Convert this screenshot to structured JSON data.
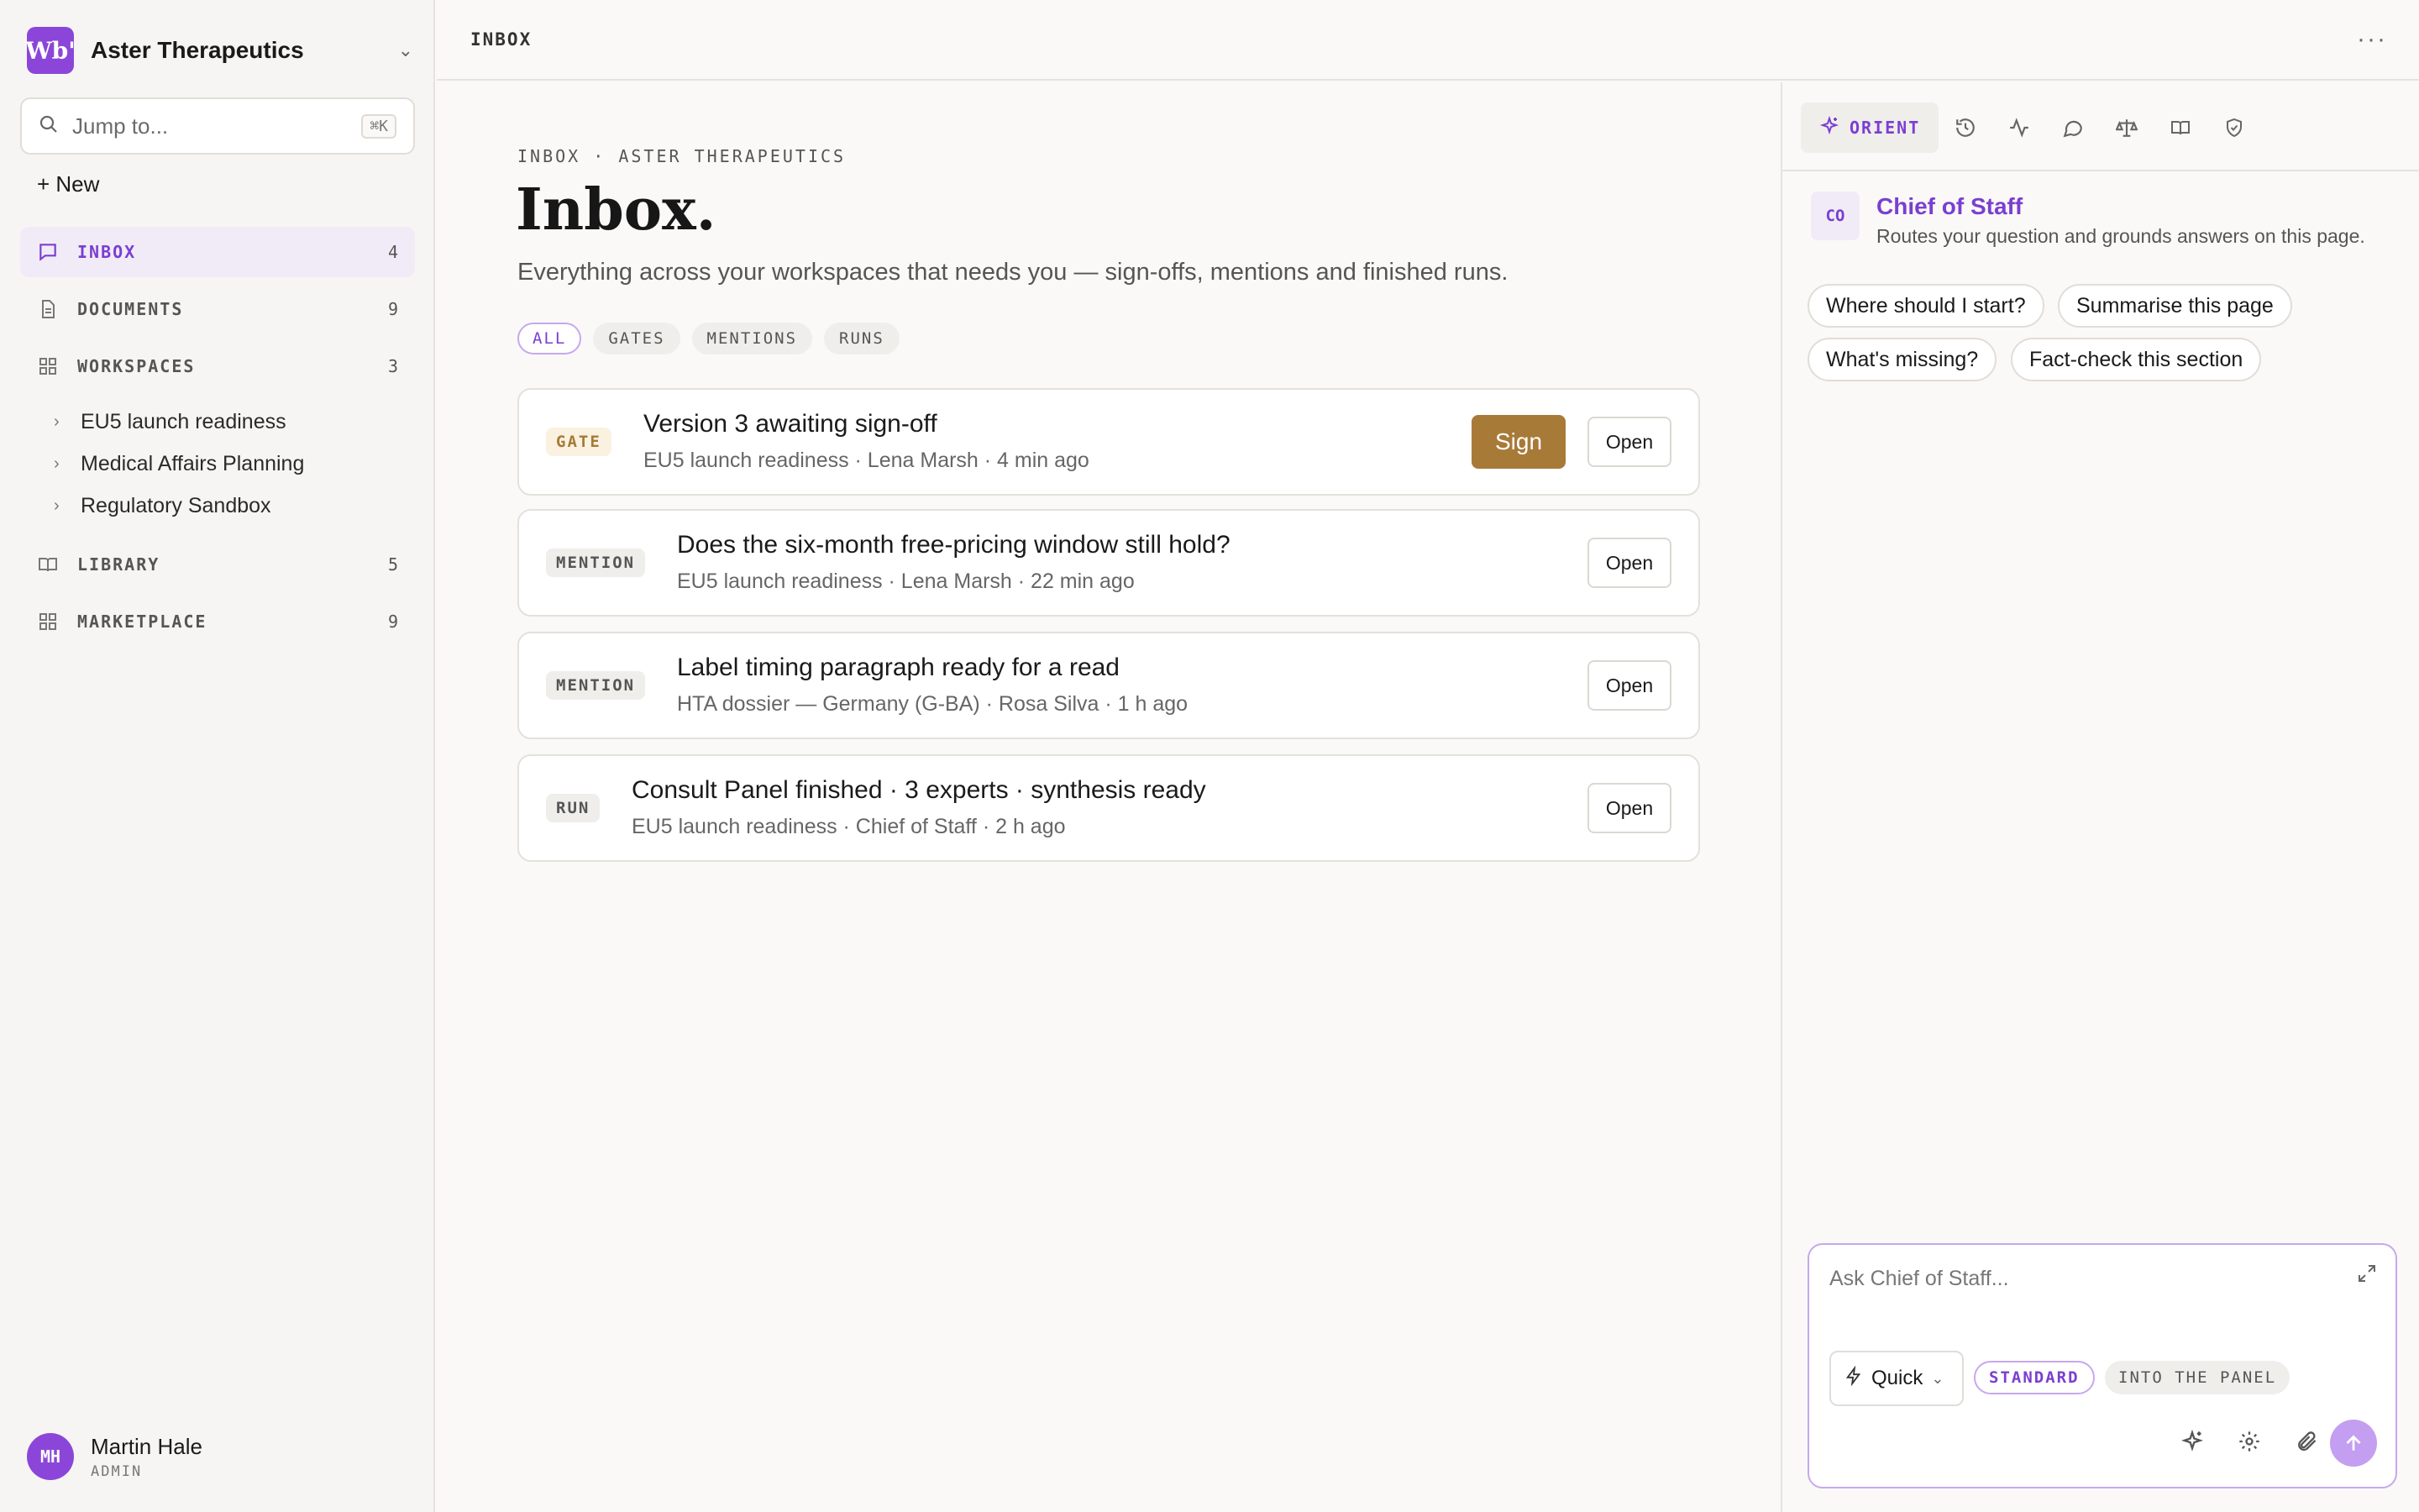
{
  "sidebar": {
    "org": {
      "logo": "Wb'",
      "name": "Aster Therapeutics"
    },
    "search": {
      "placeholder": "Jump to...",
      "shortcut": "⌘K"
    },
    "new_label": "+ New",
    "nav": [
      {
        "label": "INBOX",
        "count": "4",
        "icon": "inbox-icon",
        "active": true
      },
      {
        "label": "DOCUMENTS",
        "count": "9",
        "icon": "document-icon"
      },
      {
        "label": "WORKSPACES",
        "count": "3",
        "icon": "grid-icon"
      },
      {
        "label": "LIBRARY",
        "count": "5",
        "icon": "book-icon"
      },
      {
        "label": "MARKETPLACE",
        "count": "9",
        "icon": "grid-icon"
      }
    ],
    "workspaces": [
      {
        "label": "EU5 launch readiness"
      },
      {
        "label": "Medical Affairs Planning"
      },
      {
        "label": "Regulatory Sandbox"
      }
    ],
    "user": {
      "initials": "MH",
      "name": "Martin Hale",
      "role": "ADMIN"
    }
  },
  "topbar": {
    "breadcrumb": "INBOX",
    "menu": "···"
  },
  "main": {
    "eyebrow": "INBOX · ASTER THERAPEUTICS",
    "title": "Inbox.",
    "subtitle": "Everything across your workspaces that needs you — sign-offs, mentions and finished runs.",
    "filters": [
      {
        "label": "ALL",
        "active": true
      },
      {
        "label": "GATES"
      },
      {
        "label": "MENTIONS"
      },
      {
        "label": "RUNS"
      }
    ],
    "items": [
      {
        "tag": "GATE",
        "title": "Version 3 awaiting sign-off",
        "meta": "EU5 launch readiness · Lena Marsh · 4 min ago",
        "sign_label": "Sign",
        "open_label": "Open"
      },
      {
        "tag": "MENTION",
        "title": "Does the six-month free-pricing window still hold?",
        "meta": "EU5 launch readiness · Lena Marsh · 22 min ago",
        "open_label": "Open"
      },
      {
        "tag": "MENTION",
        "title": "Label timing paragraph ready for a read",
        "meta": "HTA dossier — Germany (G-BA) · Rosa Silva · 1 h ago",
        "open_label": "Open"
      },
      {
        "tag": "RUN",
        "title": "Consult Panel finished · 3 experts · synthesis ready",
        "meta": "EU5 launch readiness · Chief of Staff · 2 h ago",
        "open_label": "Open"
      }
    ]
  },
  "panel": {
    "tabs": {
      "orient_label": "ORIENT",
      "icons": [
        "history-icon",
        "activity-icon",
        "chat-icon",
        "scale-icon",
        "book-icon",
        "shield-check-icon"
      ]
    },
    "agent": {
      "badge": "CO",
      "name": "Chief of Staff",
      "description": "Routes your question and grounds answers on this page."
    },
    "suggestions": [
      "Where should I start?",
      "Summarise this page",
      "What's missing?",
      "Fact-check this section"
    ],
    "composer": {
      "placeholder": "Ask Chief of Staff...",
      "mode_label": "Quick",
      "chip_standard": "STANDARD",
      "chip_panel": "INTO THE PANEL"
    }
  },
  "colors": {
    "accent": "#7a3fd1",
    "brand": "#8b46d9",
    "gate": "#a87a38",
    "background": "#faf9f7"
  }
}
